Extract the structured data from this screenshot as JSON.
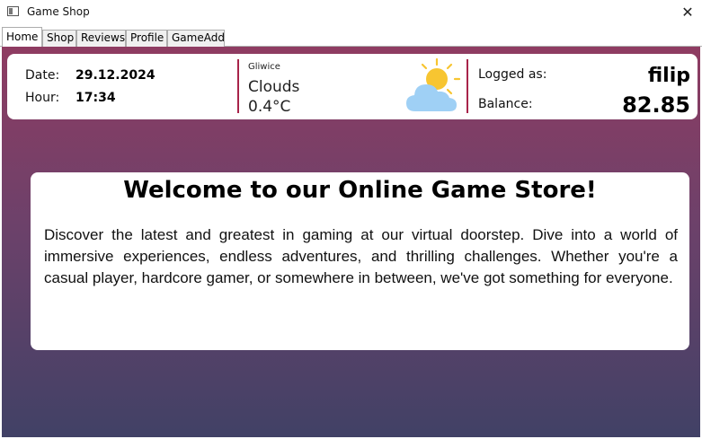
{
  "window": {
    "title": "Game Shop",
    "close_glyph": "✕"
  },
  "tabs": [
    {
      "label": "Home",
      "active": true
    },
    {
      "label": "Shop",
      "active": false
    },
    {
      "label": "Reviews",
      "active": false
    },
    {
      "label": "Profile",
      "active": false
    },
    {
      "label": "GameAdd",
      "active": false
    }
  ],
  "info": {
    "date_label": "Date:",
    "date_value": "29.12.2024",
    "hour_label": "Hour:",
    "hour_value": "17:34"
  },
  "weather": {
    "city": "Gliwice",
    "description": "Clouds",
    "temperature": "0.4°C",
    "icon": "sun-behind-cloud-icon"
  },
  "user": {
    "logged_label": "Logged as:",
    "username": "filip",
    "balance_label": "Balance:",
    "balance_value": "82.85"
  },
  "welcome": {
    "title": "Welcome to our Online Game Store!",
    "text": "Discover the latest and greatest in gaming at our virtual doorstep. Dive into a world of immersive experiences, endless adventures, and thrilling challenges. Whether you're a casual player, hardcore gamer, or somewhere in between, we've got something for everyone."
  },
  "colors": {
    "gradient_top": "#8f3c62",
    "gradient_bottom": "#414166",
    "divider": "#a8244a",
    "sun": "#f7c531",
    "cloud": "#9fd0f5"
  }
}
